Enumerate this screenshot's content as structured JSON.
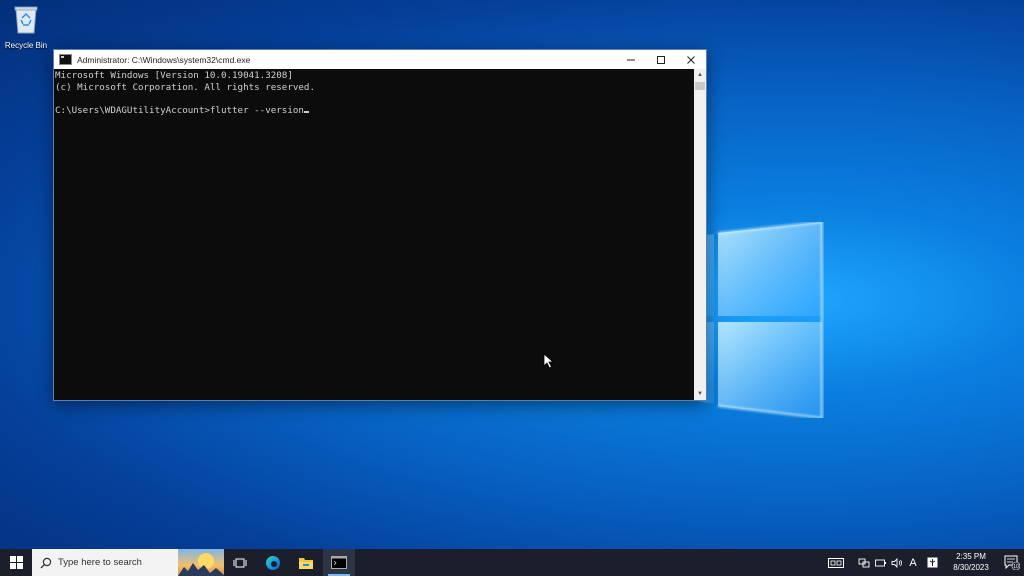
{
  "desktop": {
    "icons": [
      {
        "label": "Recycle Bin",
        "icon": "recycle-bin-icon"
      }
    ]
  },
  "window": {
    "title": "Administrator: C:\\Windows\\system32\\cmd.exe",
    "controls": {
      "minimize": "—",
      "maximize": "☐",
      "close": "✕"
    },
    "console_lines": [
      "Microsoft Windows [Version 10.0.19041.3208]",
      "(c) Microsoft Corporation. All rights reserved.",
      "",
      "C:\\Users\\WDAGUtilityAccount>flutter --version"
    ]
  },
  "taskbar": {
    "search_placeholder": "Type here to search",
    "pinned": [
      {
        "name": "task-view-icon"
      },
      {
        "name": "edge-icon"
      },
      {
        "name": "file-explorer-icon"
      },
      {
        "name": "command-prompt-icon",
        "active": true
      }
    ],
    "tray": {
      "ime_label": "A",
      "time": "2:35 PM",
      "date": "8/30/2023",
      "notification_count": "10"
    }
  }
}
